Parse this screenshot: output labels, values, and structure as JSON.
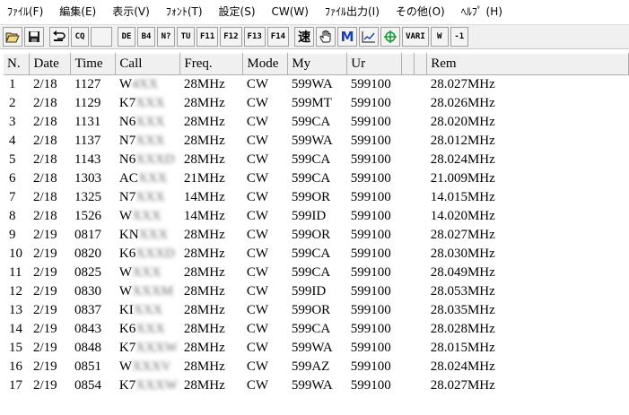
{
  "menu": [
    {
      "label": "ﾌｧｲﾙ(F)"
    },
    {
      "label": "編集(E)"
    },
    {
      "label": "表示(V)"
    },
    {
      "label": "ﾌｫﾝﾄ(T)"
    },
    {
      "label": "設定(S)"
    },
    {
      "label": "CW(W)"
    },
    {
      "label": "ﾌｧｲﾙ出力(I)"
    },
    {
      "label": "その他(O)"
    },
    {
      "label": "ﾍﾙﾌﾟ (H)"
    }
  ],
  "toolbar": {
    "open_icon": "folder-open-icon",
    "save_icon": "save-icon",
    "undo_icon": "undo-icon",
    "cq": "CQ",
    "de": "DE",
    "b4": "B4",
    "nq": "N?",
    "tu": "TU",
    "f11": "F11",
    "f12": "F12",
    "f13": "F13",
    "f14": "F14",
    "speed": "速",
    "hand_icon": "hand-icon",
    "m": "M",
    "graph_icon": "graph-icon",
    "crosshair_icon": "crosshair-icon",
    "vari": "VARI",
    "w": "W",
    "minus1": "-1"
  },
  "table": {
    "headers": [
      "N.",
      "Date",
      "Time",
      "Call",
      "Freq.",
      "Mode",
      "My",
      "Ur",
      "",
      "",
      "Rem"
    ],
    "rows": [
      {
        "n": "1",
        "date": "2/18",
        "time": "1127",
        "call": "W",
        "call_hidden": "4XX",
        "freq": "28MHz",
        "mode": "CW",
        "my": "599WA",
        "ur": "599100",
        "rem": "28.027MHz"
      },
      {
        "n": "2",
        "date": "2/18",
        "time": "1129",
        "call": "K7",
        "call_hidden": "XXX",
        "freq": "28MHz",
        "mode": "CW",
        "my": "599MT",
        "ur": "599100",
        "rem": "28.026MHz"
      },
      {
        "n": "3",
        "date": "2/18",
        "time": "1131",
        "call": "N6",
        "call_hidden": "XXX",
        "freq": "28MHz",
        "mode": "CW",
        "my": "599CA",
        "ur": "599100",
        "rem": "28.020MHz"
      },
      {
        "n": "4",
        "date": "2/18",
        "time": "1137",
        "call": "N7",
        "call_hidden": "XXX",
        "freq": "28MHz",
        "mode": "CW",
        "my": "599WA",
        "ur": "599100",
        "rem": "28.012MHz"
      },
      {
        "n": "5",
        "date": "2/18",
        "time": "1143",
        "call": "N6",
        "call_hidden": "XXXD",
        "freq": "28MHz",
        "mode": "CW",
        "my": "599CA",
        "ur": "599100",
        "rem": "28.024MHz"
      },
      {
        "n": "6",
        "date": "2/18",
        "time": "1303",
        "call": "AC",
        "call_hidden": "XXX",
        "freq": "21MHz",
        "mode": "CW",
        "my": "599CA",
        "ur": "599100",
        "rem": "21.009MHz"
      },
      {
        "n": "7",
        "date": "2/18",
        "time": "1325",
        "call": "N7",
        "call_hidden": "XXX",
        "freq": "14MHz",
        "mode": "CW",
        "my": "599OR",
        "ur": "599100",
        "rem": "14.015MHz"
      },
      {
        "n": "8",
        "date": "2/18",
        "time": "1526",
        "call": "W",
        "call_hidden": "XXX",
        "freq": "14MHz",
        "mode": "CW",
        "my": "599ID",
        "ur": "599100",
        "rem": "14.020MHz"
      },
      {
        "n": "9",
        "date": "2/19",
        "time": "0817",
        "call": "KN",
        "call_hidden": "XXX",
        "freq": "28MHz",
        "mode": "CW",
        "my": "599OR",
        "ur": "599100",
        "rem": "28.027MHz"
      },
      {
        "n": "10",
        "date": "2/19",
        "time": "0820",
        "call": "K6",
        "call_hidden": "XXXD",
        "freq": "28MHz",
        "mode": "CW",
        "my": "599CA",
        "ur": "599100",
        "rem": "28.030MHz"
      },
      {
        "n": "11",
        "date": "2/19",
        "time": "0825",
        "call": "W",
        "call_hidden": "XXX",
        "freq": "28MHz",
        "mode": "CW",
        "my": "599CA",
        "ur": "599100",
        "rem": "28.049MHz"
      },
      {
        "n": "12",
        "date": "2/19",
        "time": "0830",
        "call": "W",
        "call_hidden": "XXXM",
        "freq": "28MHz",
        "mode": "CW",
        "my": "599ID",
        "ur": "599100",
        "rem": "28.053MHz"
      },
      {
        "n": "13",
        "date": "2/19",
        "time": "0837",
        "call": "KI",
        "call_hidden": "XXX",
        "freq": "28MHz",
        "mode": "CW",
        "my": "599OR",
        "ur": "599100",
        "rem": "28.035MHz"
      },
      {
        "n": "14",
        "date": "2/19",
        "time": "0843",
        "call": "K6",
        "call_hidden": "XXX",
        "freq": "28MHz",
        "mode": "CW",
        "my": "599CA",
        "ur": "599100",
        "rem": "28.028MHz"
      },
      {
        "n": "15",
        "date": "2/19",
        "time": "0848",
        "call": "K7",
        "call_hidden": "XXXW",
        "freq": "28MHz",
        "mode": "CW",
        "my": "599WA",
        "ur": "599100",
        "rem": "28.015MHz"
      },
      {
        "n": "16",
        "date": "2/19",
        "time": "0851",
        "call": "W",
        "call_hidden": "XXXV",
        "freq": "28MHz",
        "mode": "CW",
        "my": "599AZ",
        "ur": "599100",
        "rem": "28.024MHz"
      },
      {
        "n": "17",
        "date": "2/19",
        "time": "0854",
        "call": "K7",
        "call_hidden": "XXXW",
        "freq": "28MHz",
        "mode": "CW",
        "my": "599WA",
        "ur": "599100",
        "rem": "28.027MHz"
      }
    ]
  }
}
